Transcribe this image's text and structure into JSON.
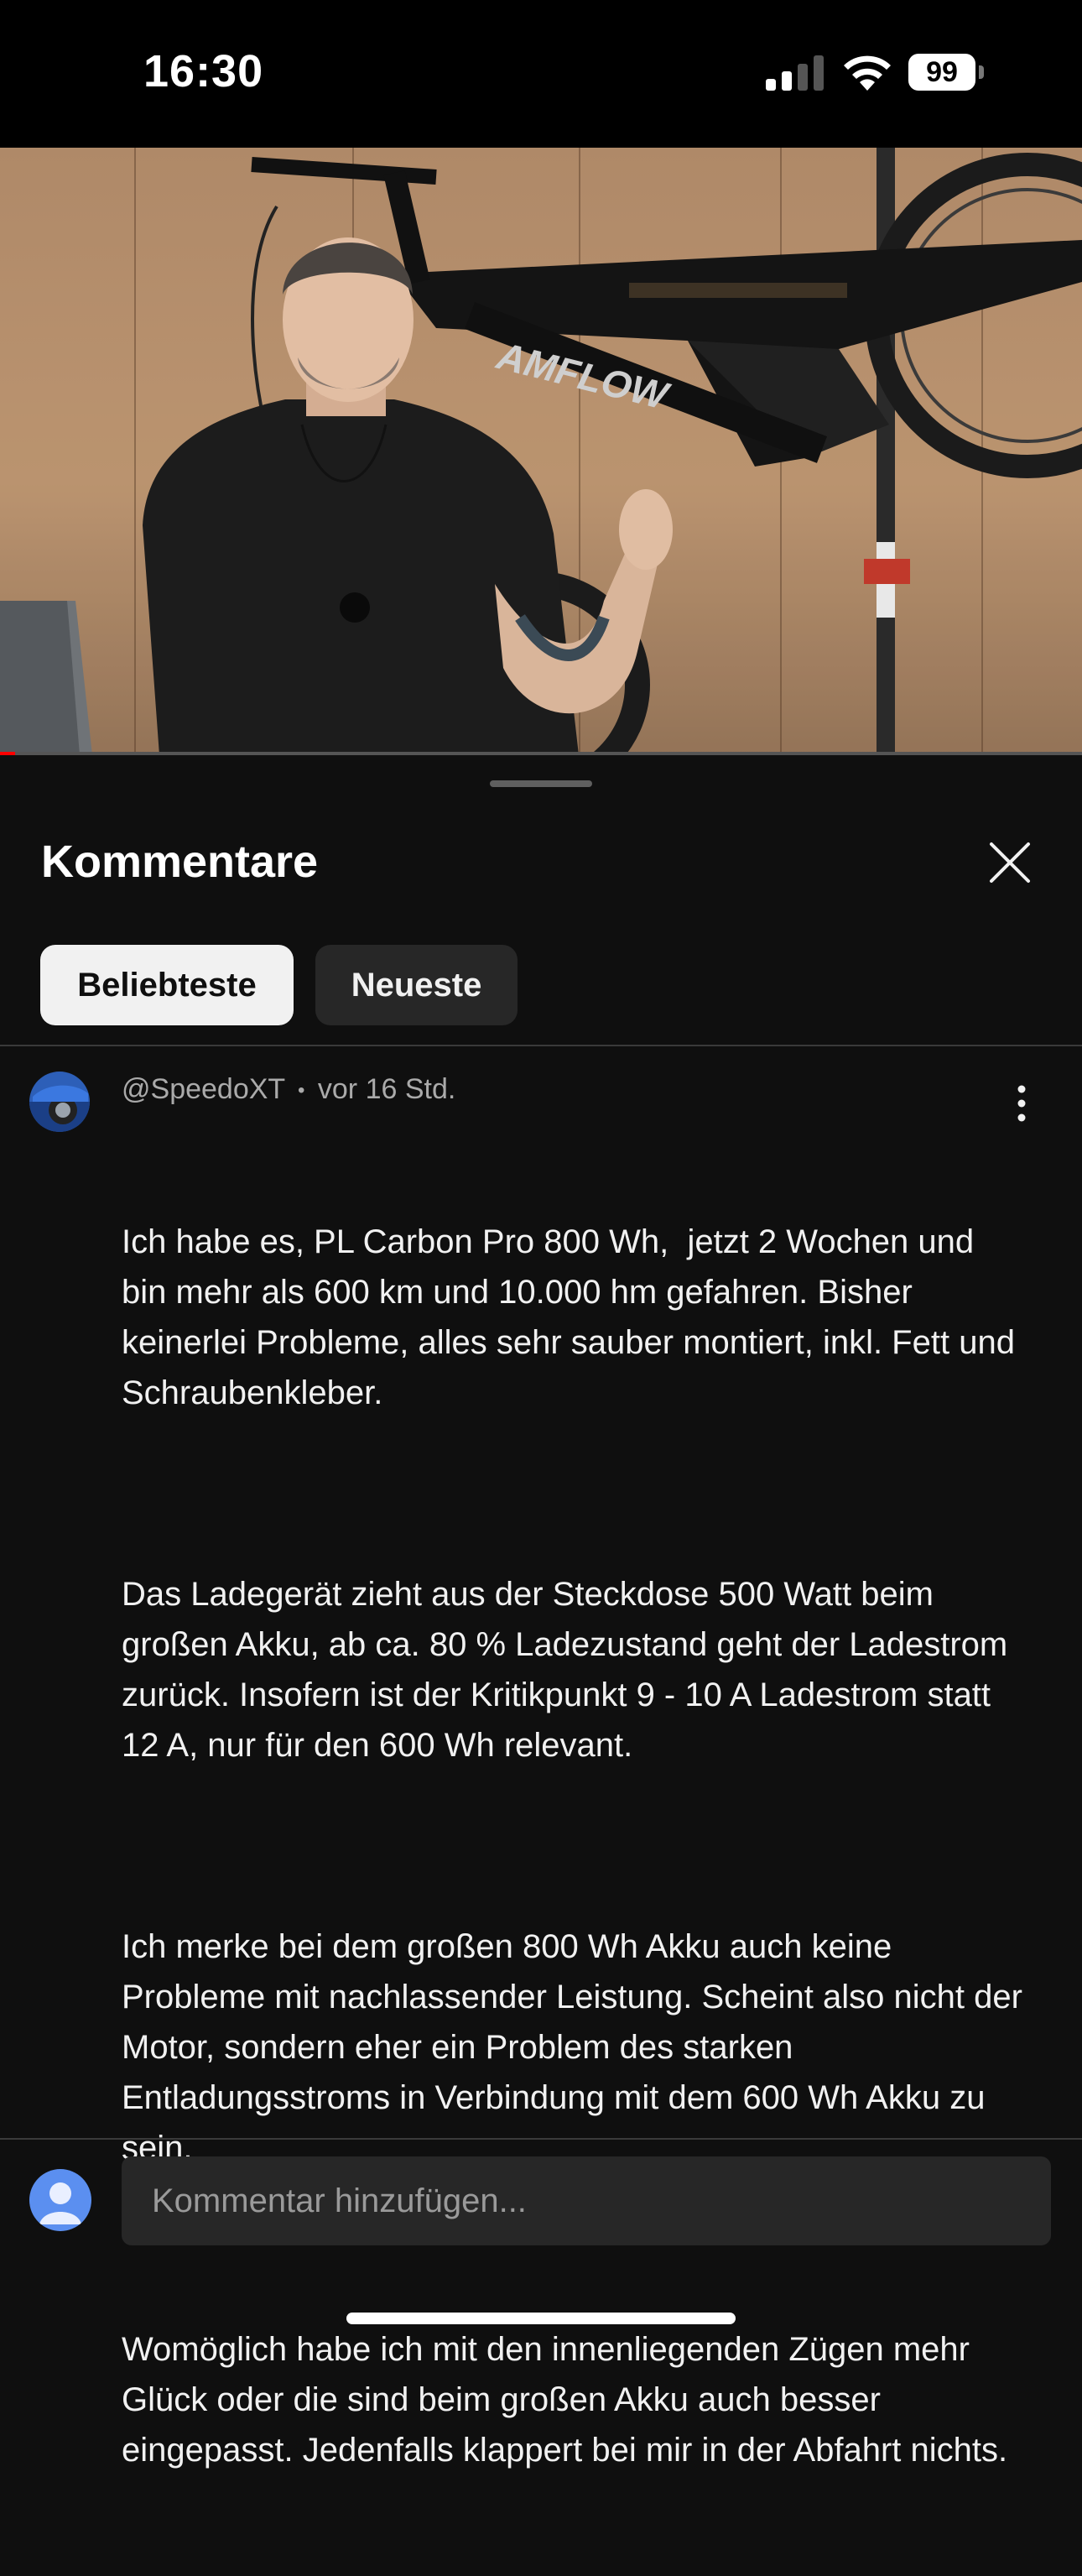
{
  "status_bar": {
    "time": "16:30",
    "battery_level": "99",
    "icons": [
      "cellular-signal-icon",
      "wifi-icon",
      "battery-icon"
    ]
  },
  "video": {
    "frame_brand_text": "AMFLOW",
    "progress_fraction": 0.014,
    "progress_color": "#ff0000"
  },
  "comments_panel": {
    "title": "Kommentare",
    "close_icon": "close-icon",
    "filters": [
      {
        "label": "Beliebteste",
        "selected": true
      },
      {
        "label": "Neueste",
        "selected": false
      }
    ]
  },
  "comment": {
    "author": "@SpeedoXT",
    "separator": "•",
    "time_ago": "vor 16 Std.",
    "more_icon": "more-vert-icon",
    "paragraphs": [
      "Ich habe es, PL Carbon Pro 800 Wh,  jetzt 2 Wochen und bin mehr als 600 km und 10.000 hm gefahren. Bisher keinerlei Probleme, alles sehr sauber montiert, inkl. Fett und Schraubenkleber.",
      "Das Ladegerät zieht aus der Steckdose 500 Watt beim großen Akku, ab ca. 80 % Ladezustand geht der Ladestrom zurück. Insofern ist der Kritikpunkt 9 - 10 A Ladestrom statt 12 A, nur für den 600 Wh relevant.",
      "Ich merke bei dem großen 800 Wh Akku auch keine Probleme mit nachlassender Leistung. Scheint also nicht der Motor, sondern eher ein Problem des starken Entladungsstroms in Verbindung mit dem 600 Wh Akku zu sein.",
      "Womöglich habe ich mit den innenliegenden Zügen mehr Glück oder die sind beim großen Akku auch besser eingepasst. Jedenfalls klappert bei mir in der Abfahrt nichts."
    ]
  },
  "composer": {
    "placeholder": "Kommentar hinzufügen...",
    "user_avatar_icon": "user-avatar-icon"
  },
  "colors": {
    "background": "#0f0f0f",
    "chip_active_bg": "#f1f1f1",
    "chip_inactive_bg": "#272727",
    "meta_text": "#aaaaaa",
    "user_avatar": "#5b8ff0"
  }
}
